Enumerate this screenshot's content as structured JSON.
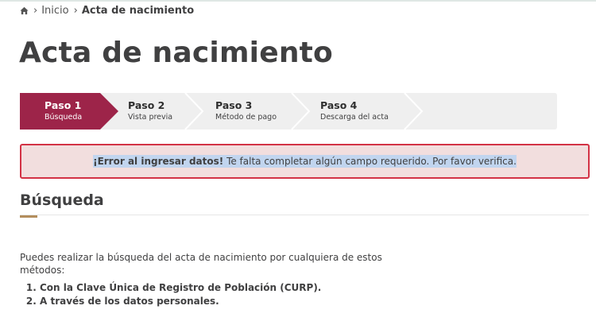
{
  "breadcrumb": {
    "home_icon": "home-icon",
    "items": [
      "Inicio",
      "Acta de nacimiento"
    ]
  },
  "page": {
    "title": "Acta de nacimiento"
  },
  "stepper": {
    "colors": {
      "active": "#9d2449",
      "inactive": "#efefef",
      "separator": "#ffffff"
    },
    "steps": [
      {
        "title": "Paso 1",
        "subtitle": "Búsqueda",
        "active": true
      },
      {
        "title": "Paso 2",
        "subtitle": "Vista previa",
        "active": false
      },
      {
        "title": "Paso 3",
        "subtitle": "Método de pago",
        "active": false
      },
      {
        "title": "Paso 4",
        "subtitle": "Descarga del acta",
        "active": false
      }
    ]
  },
  "alert": {
    "strong": "¡Error al ingresar datos!",
    "message": " Te falta completar algún campo requerido. Por favor verifica.",
    "colors": {
      "background": "#f2dede",
      "border": "#d33245",
      "selection": "#c1d5ef"
    }
  },
  "section": {
    "title": "Búsqueda",
    "accent_color": "#b38e5d",
    "intro": "Puedes realizar la búsqueda del acta de nacimiento por cualquiera de estos métodos:",
    "methods": [
      "Con la Clave Única de Registro de Población (CURP).",
      "A través de los datos personales."
    ]
  }
}
